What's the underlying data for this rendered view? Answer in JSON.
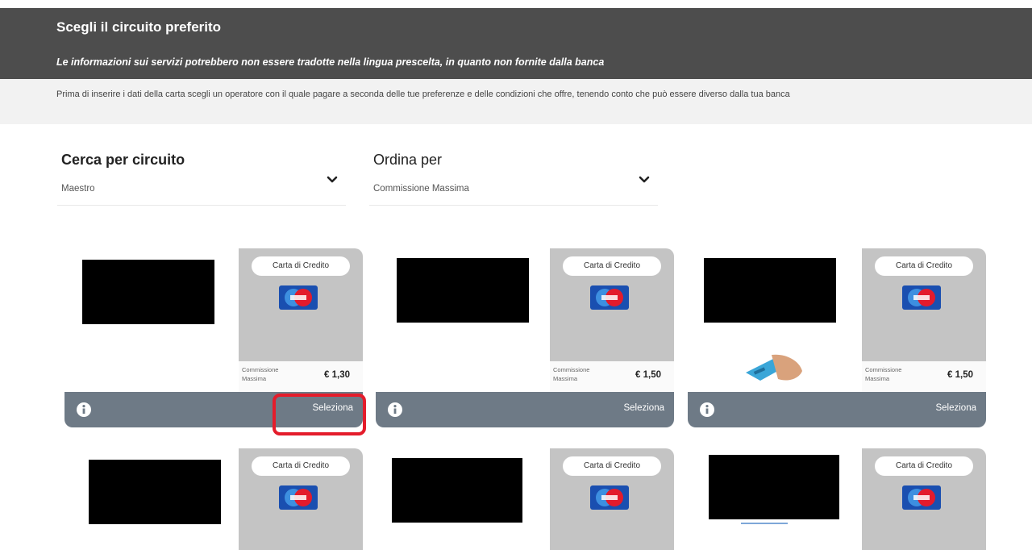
{
  "header": {
    "title": "Scegli il circuito preferito",
    "note": "Le informazioni sui servizi potrebbero non essere tradotte nella lingua prescelta, in quanto non fornite dalla banca"
  },
  "info_text": "Prima di inserire i dati della carta scegli un operatore con il quale pagare a seconda delle tue preferenze e delle condizioni che offre, tenendo conto che può essere diverso dalla tua banca",
  "filters": {
    "circuit": {
      "label": "Cerca per circuito",
      "value": "Maestro"
    },
    "sort": {
      "label": "Ordina per",
      "value": "Commissione Massima"
    }
  },
  "cards": [
    {
      "type": "Carta di Credito",
      "brand_icon": "maestro-logo",
      "commission_label": "Commissione Massima",
      "commission_value": "€ 1,30",
      "select_label": "Seleziona",
      "info_icon": "info-icon"
    },
    {
      "type": "Carta di Credito",
      "brand_icon": "maestro-logo",
      "commission_label": "Commissione Massima",
      "commission_value": "€ 1,50",
      "select_label": "Seleziona",
      "info_icon": "info-icon"
    },
    {
      "type": "Carta di Credito",
      "brand_icon": "maestro-logo",
      "commission_label": "Commissione Massima",
      "commission_value": "€ 1,50",
      "select_label": "Seleziona",
      "info_icon": "info-icon"
    },
    {
      "type": "Carta di Credito",
      "brand_icon": "maestro-logo"
    },
    {
      "type": "Carta di Credito",
      "brand_icon": "maestro-logo"
    },
    {
      "type": "Carta di Credito",
      "brand_icon": "maestro-logo"
    }
  ],
  "colors": {
    "header_bg": "#4d4d4d",
    "info_bg": "#f2f2f2",
    "card_side_bg": "#c4c4c4",
    "card_footer_bg": "#6e7a86",
    "highlight": "#e41c2b",
    "maestro_blue": "#1a4fb0",
    "maestro_red": "#e31b2c"
  }
}
